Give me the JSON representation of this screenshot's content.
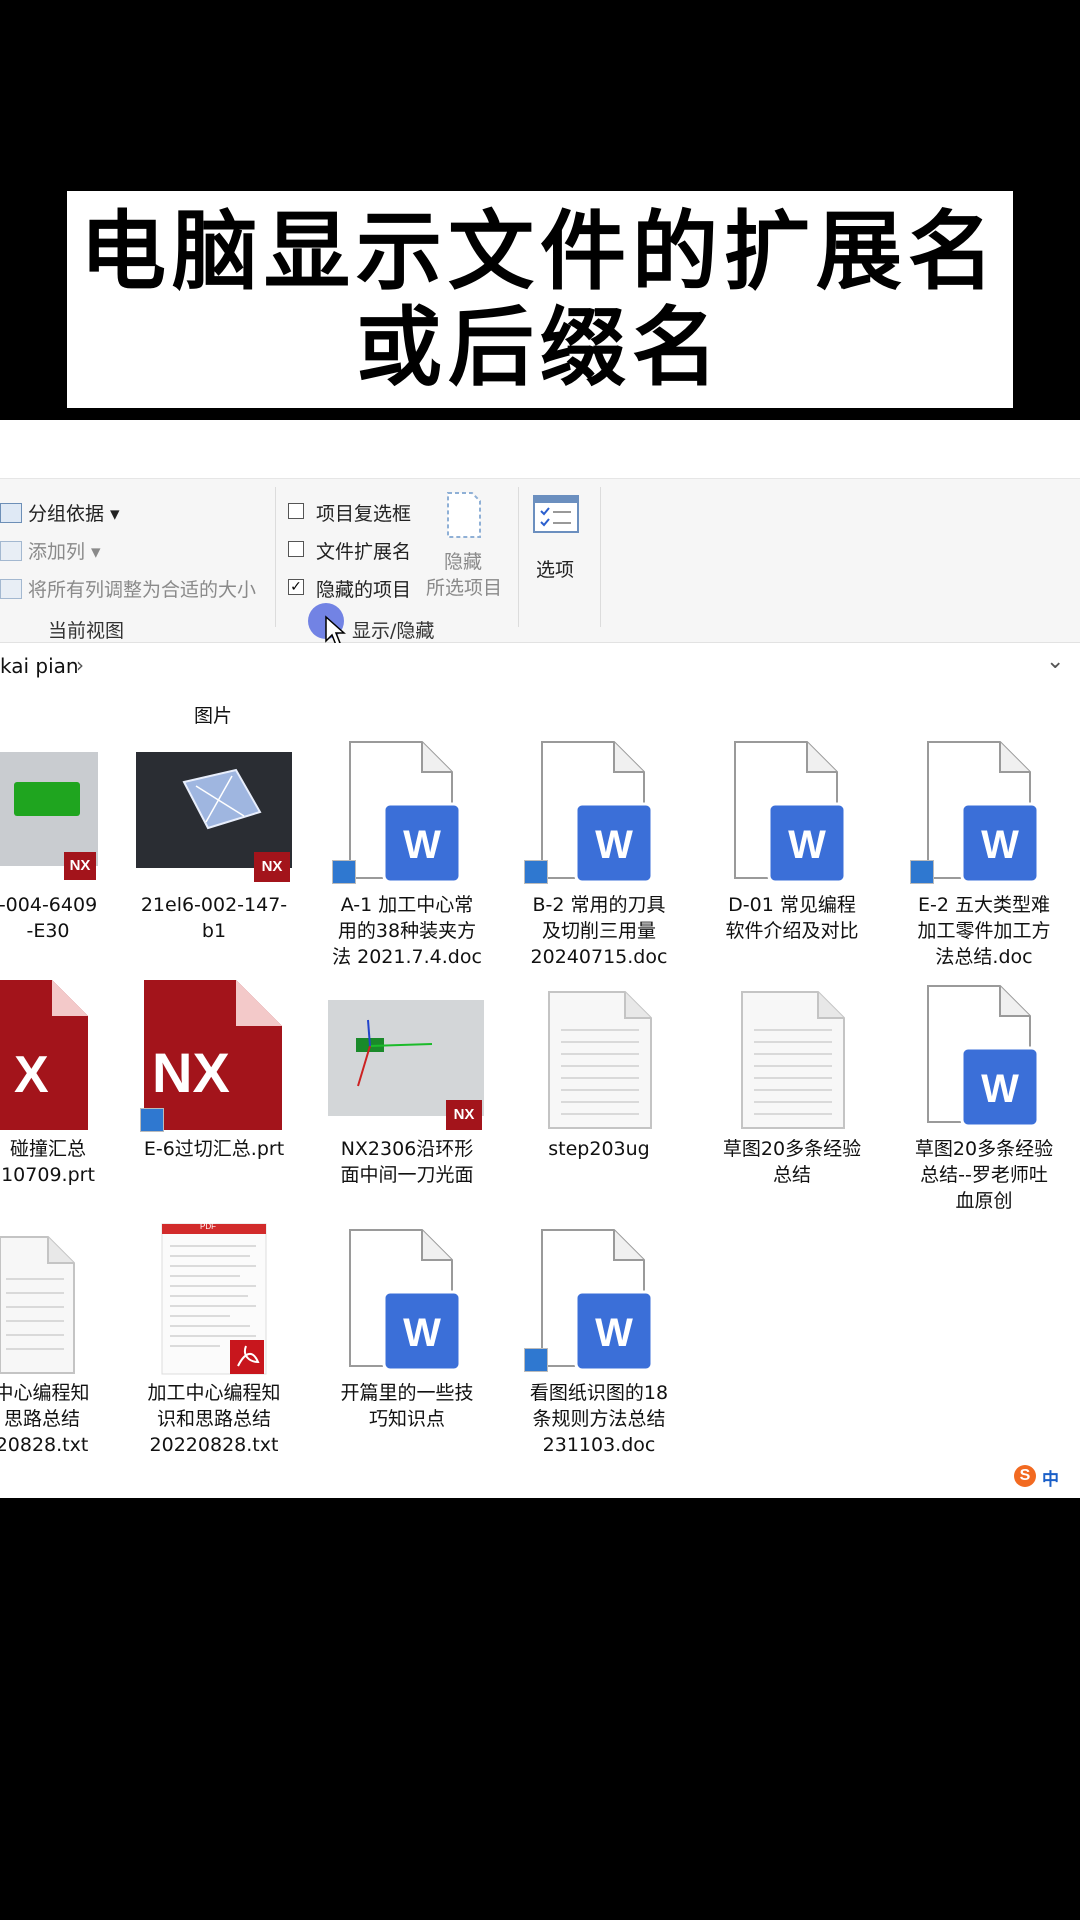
{
  "title": {
    "line1": "电脑显示文件的扩展名",
    "line2": "或后缀名"
  },
  "ribbon": {
    "group_by": "分组依据",
    "add_column": "添加列",
    "size_all_columns": "将所有列调整为合适的大小",
    "current_view_label": "当前视图",
    "item_checkboxes": "项目复选框",
    "file_extensions": "文件扩展名",
    "hidden_items": "隐藏的项目",
    "hide_selected_line1": "隐藏",
    "hide_selected_line2": "所选项目",
    "options": "选项",
    "show_hide_label": "显示/隐藏",
    "checks": {
      "item_checkboxes": false,
      "file_extensions": false,
      "hidden_items": true
    }
  },
  "address": {
    "path": "kai pian"
  },
  "group_header": "图片",
  "files_row1": [
    {
      "line1": "-004-6409",
      "line2": "-E30"
    },
    {
      "line1": "21el6-002-147-",
      "line2": "b1"
    },
    {
      "line1": "A-1 加工中心常",
      "line2": "用的38种装夹方",
      "line3": "法 2021.7.4.doc"
    },
    {
      "line1": "B-2 常用的刀具",
      "line2": "及切削三用量",
      "line3": "20240715.doc"
    },
    {
      "line1": "D-01 常见编程",
      "line2": "软件介绍及对比"
    },
    {
      "line1": "E-2 五大类型难",
      "line2": "加工零件加工方",
      "line3": "法总结.doc"
    }
  ],
  "files_row2": [
    {
      "line1": "碰撞汇总",
      "line2": "10709.prt"
    },
    {
      "line1": "E-6过切汇总.prt"
    },
    {
      "line1": "NX2306沿环形",
      "line2": "面中间一刀光面"
    },
    {
      "line1": "step203ug"
    },
    {
      "line1": "草图20多条经验",
      "line2": "总结"
    },
    {
      "line1": "草图20多条经验",
      "line2": "总结--罗老师吐",
      "line3": "血原创"
    }
  ],
  "files_row3": [
    {
      "line1": "中心编程知",
      "line2": "思路总结",
      "line3": "20828.txt"
    },
    {
      "line1": "加工中心编程知",
      "line2": "识和思路总结",
      "line3": "20220828.txt"
    },
    {
      "line1": "开篇里的一些技",
      "line2": "巧知识点"
    },
    {
      "line1": "看图纸识图的18",
      "line2": "条规则方法总结",
      "line3": "231103.doc"
    }
  ],
  "badges": {
    "nx": "NX",
    "word": "W",
    "pdf": "PDF",
    "sogou": "中"
  },
  "colors": {
    "word_blue": "#2b5fce",
    "nx_red": "#a3141b",
    "accent": "#3b7ee8"
  }
}
